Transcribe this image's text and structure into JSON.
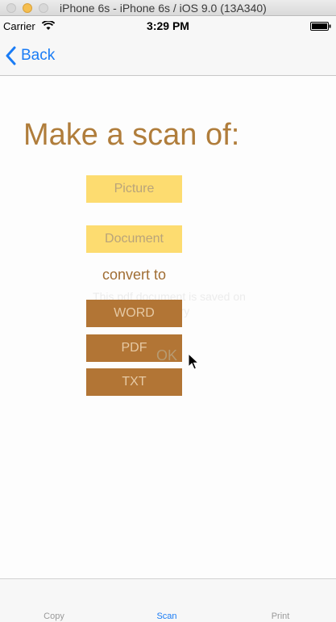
{
  "window": {
    "title": "iPhone 6s - iPhone 6s / iOS 9.0 (13A340)"
  },
  "status_bar": {
    "carrier": "Carrier",
    "time": "3:29 PM"
  },
  "nav": {
    "back_label": "Back"
  },
  "main": {
    "heading": "Make a scan of:",
    "source_buttons": [
      "Picture",
      "Document"
    ],
    "convert_label": "convert to",
    "format_buttons": [
      "WORD",
      "PDF",
      "TXT"
    ],
    "alert_message": "This pdf document is saved on memory",
    "alert_ok": "OK"
  },
  "tabs": [
    "Copy",
    "Scan",
    "Print"
  ],
  "colors": {
    "accent": "#1a7cf5",
    "heading": "#b07d3b",
    "yellow_button": "#fddc70",
    "brown_button": "#b27535"
  }
}
